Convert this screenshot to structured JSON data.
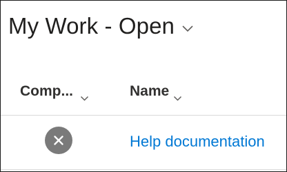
{
  "view": {
    "title": "My Work - Open"
  },
  "columns": [
    {
      "label": "Comp...",
      "icon": "chevron-down-icon"
    },
    {
      "label": "Name",
      "icon": "chevron-down-icon"
    }
  ],
  "rows": [
    {
      "status_icon": "close-circle-icon",
      "name": "Help documentation"
    }
  ],
  "colors": {
    "link": "#0078d4",
    "status_icon_bg": "#7a7a7a",
    "text": "#201f1e",
    "divider": "#d9d9d9"
  }
}
